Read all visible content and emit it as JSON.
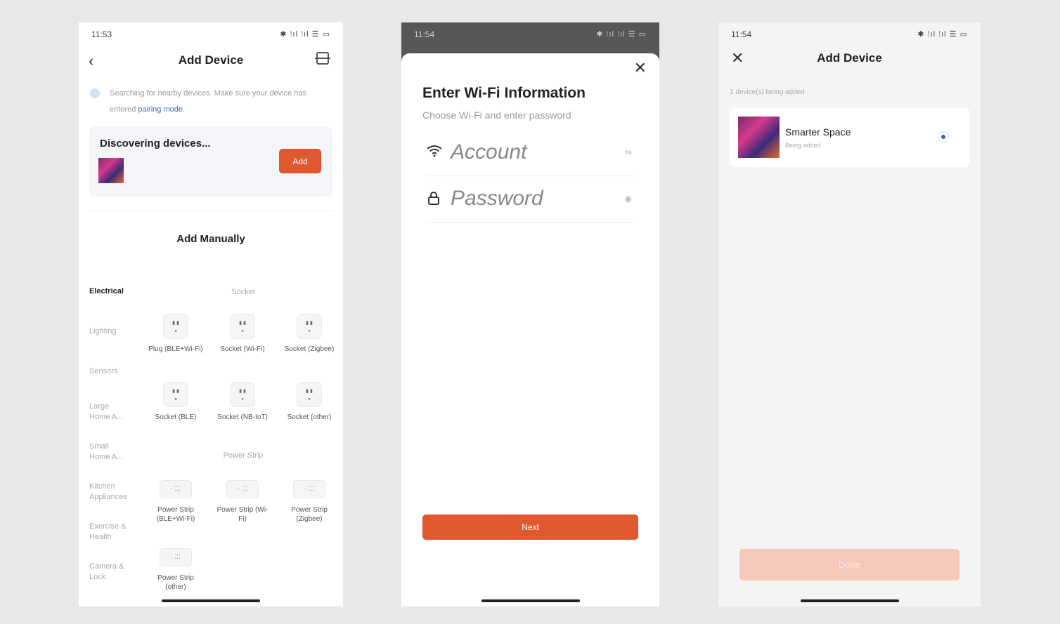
{
  "screen1": {
    "status_time": "11:53",
    "status_right": "✱ ⁞ıl ⁞ıl ☰ ▭",
    "title": "Add Device",
    "hint_text": "Searching for nearby devices. Make sure your device has entered",
    "hint_link": "pairing mode.",
    "discovering_title": "Discovering devices...",
    "add_label": "Add",
    "manual_title": "Add Manually",
    "categories": [
      "Electrical",
      "Lighting",
      "Sensors",
      "Large Home A...",
      "Small Home A...",
      "Kitchen Appliances",
      "Exercise & Health",
      "Camera & Lock"
    ],
    "section_socket": "Socket",
    "section_strip": "Power Strip",
    "sockets": [
      {
        "label": "Plug (BLE+Wi-Fi)"
      },
      {
        "label": "Socket (Wi-Fi)"
      },
      {
        "label": "Socket (Zigbee)"
      },
      {
        "label": "Socket (BLE)"
      },
      {
        "label": "Socket (NB-IoT)"
      },
      {
        "label": "Socket (other)"
      }
    ],
    "strips": [
      {
        "label": "Power Strip (BLE+Wi-Fi)"
      },
      {
        "label": "Power Strip (Wi-Fi)"
      },
      {
        "label": "Power Strip (Zigbee)"
      },
      {
        "label": "Power Strip (other)"
      }
    ]
  },
  "screen2": {
    "status_time": "11:54",
    "status_right": "✱ ⁞ıl ⁞ıl ☰ ▭",
    "title": "Enter Wi-Fi Information",
    "subtitle": "Choose Wi-Fi and enter password",
    "account_placeholder": "Account",
    "password_placeholder": "Password",
    "next_label": "Next"
  },
  "screen3": {
    "status_time": "11:54",
    "status_right": "✱ ⁞ıl ⁞ıl ☰ ▭",
    "title": "Add Device",
    "adding_text": "1 device(s) being added",
    "device_name": "Smarter Space",
    "device_status": "Being added",
    "done_label": "Done"
  }
}
